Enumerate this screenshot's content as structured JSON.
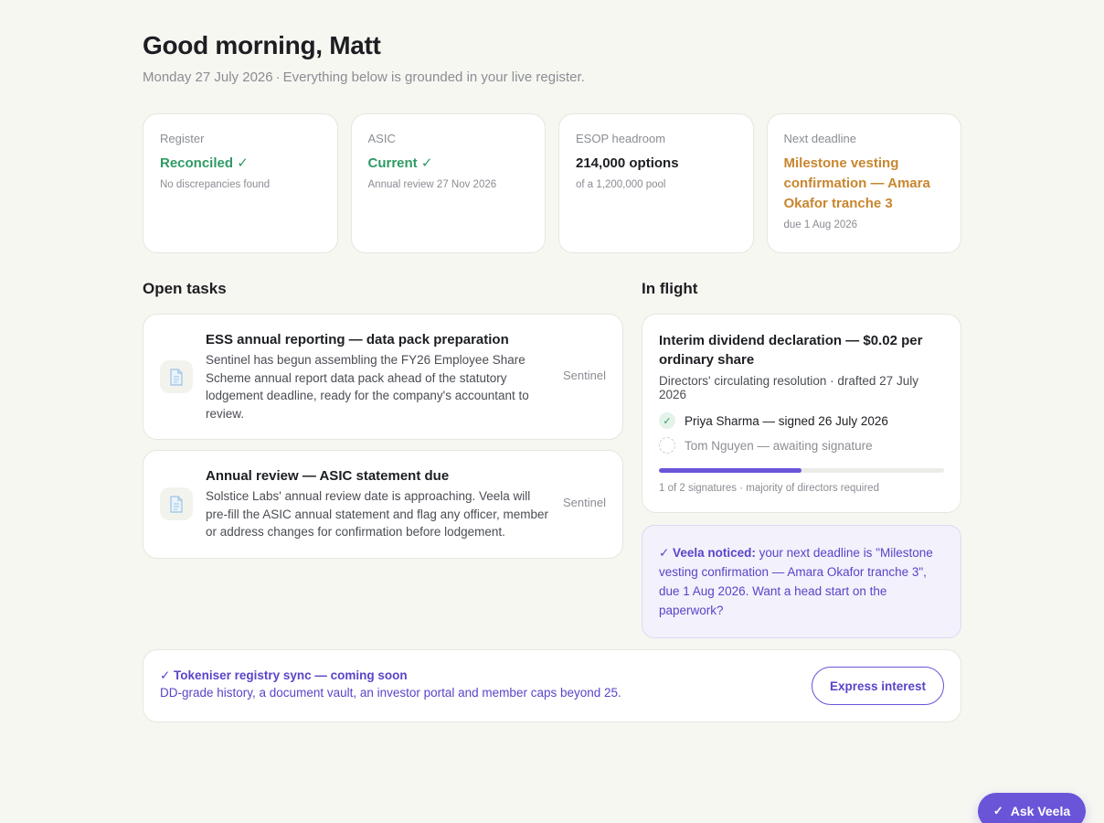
{
  "header": {
    "greeting": "Good morning, Matt",
    "date": "Monday 27 July 2026",
    "separator": "·",
    "tagline": "Everything below is grounded in your live register."
  },
  "stats": [
    {
      "label": "Register",
      "value": "Reconciled ✓",
      "sub": "No discrepancies found"
    },
    {
      "label": "ASIC",
      "value": "Current ✓",
      "sub": "Annual review 27 Nov 2026"
    },
    {
      "label": "ESOP headroom",
      "value": "214,000 options",
      "sub": "of a 1,200,000 pool"
    },
    {
      "label": "Next deadline",
      "value": "Milestone vesting confirmation — Amara Okafor tranche 3",
      "sub": "due 1 Aug 2026"
    }
  ],
  "open_tasks": {
    "title": "Open tasks",
    "items": [
      {
        "title": "ESS annual reporting — data pack preparation",
        "description": "Sentinel has begun assembling the FY26 Employee Share Scheme annual report data pack ahead of the statutory lodgement deadline, ready for the company's accountant to review.",
        "tag": "Sentinel",
        "icon": "document-icon"
      },
      {
        "title": "Annual review — ASIC statement due",
        "description": "Solstice Labs' annual review date is approaching. Veela will pre-fill the ASIC annual statement and flag any officer, member or address changes for confirmation before lodgement.",
        "tag": "Sentinel",
        "icon": "document-icon"
      }
    ]
  },
  "in_flight": {
    "title": "In flight",
    "card": {
      "title": "Interim dividend declaration — $0.02 per ordinary share",
      "meta": "Directors' circulating resolution · drafted 27 July 2026",
      "signers": [
        {
          "text": "Priya Sharma — signed 26 July 2026",
          "status": "signed"
        },
        {
          "text": "Tom Nguyen — awaiting signature",
          "status": "pending"
        }
      ],
      "progress": 0.5,
      "progress_text": "1 of 2 signatures · majority of directors required"
    },
    "notice": {
      "lead": "✓ Veela noticed:",
      "body": " your next deadline is \"Milestone vesting confirmation — Amara Okafor tranche 3\", due 1 Aug 2026. Want a head start on the paperwork?"
    }
  },
  "banner": {
    "title": "✓ Tokeniser registry sync — coming soon",
    "subtitle": "DD-grade history, a document vault, an investor portal and member caps beyond 25.",
    "button": "Express interest"
  },
  "ask_button": {
    "check": "✓",
    "label": "Ask Veela"
  },
  "colors": {
    "accent": "#6a54d8",
    "success": "#2f9a64",
    "warning": "#c8862f",
    "background": "#f7f7f2"
  }
}
